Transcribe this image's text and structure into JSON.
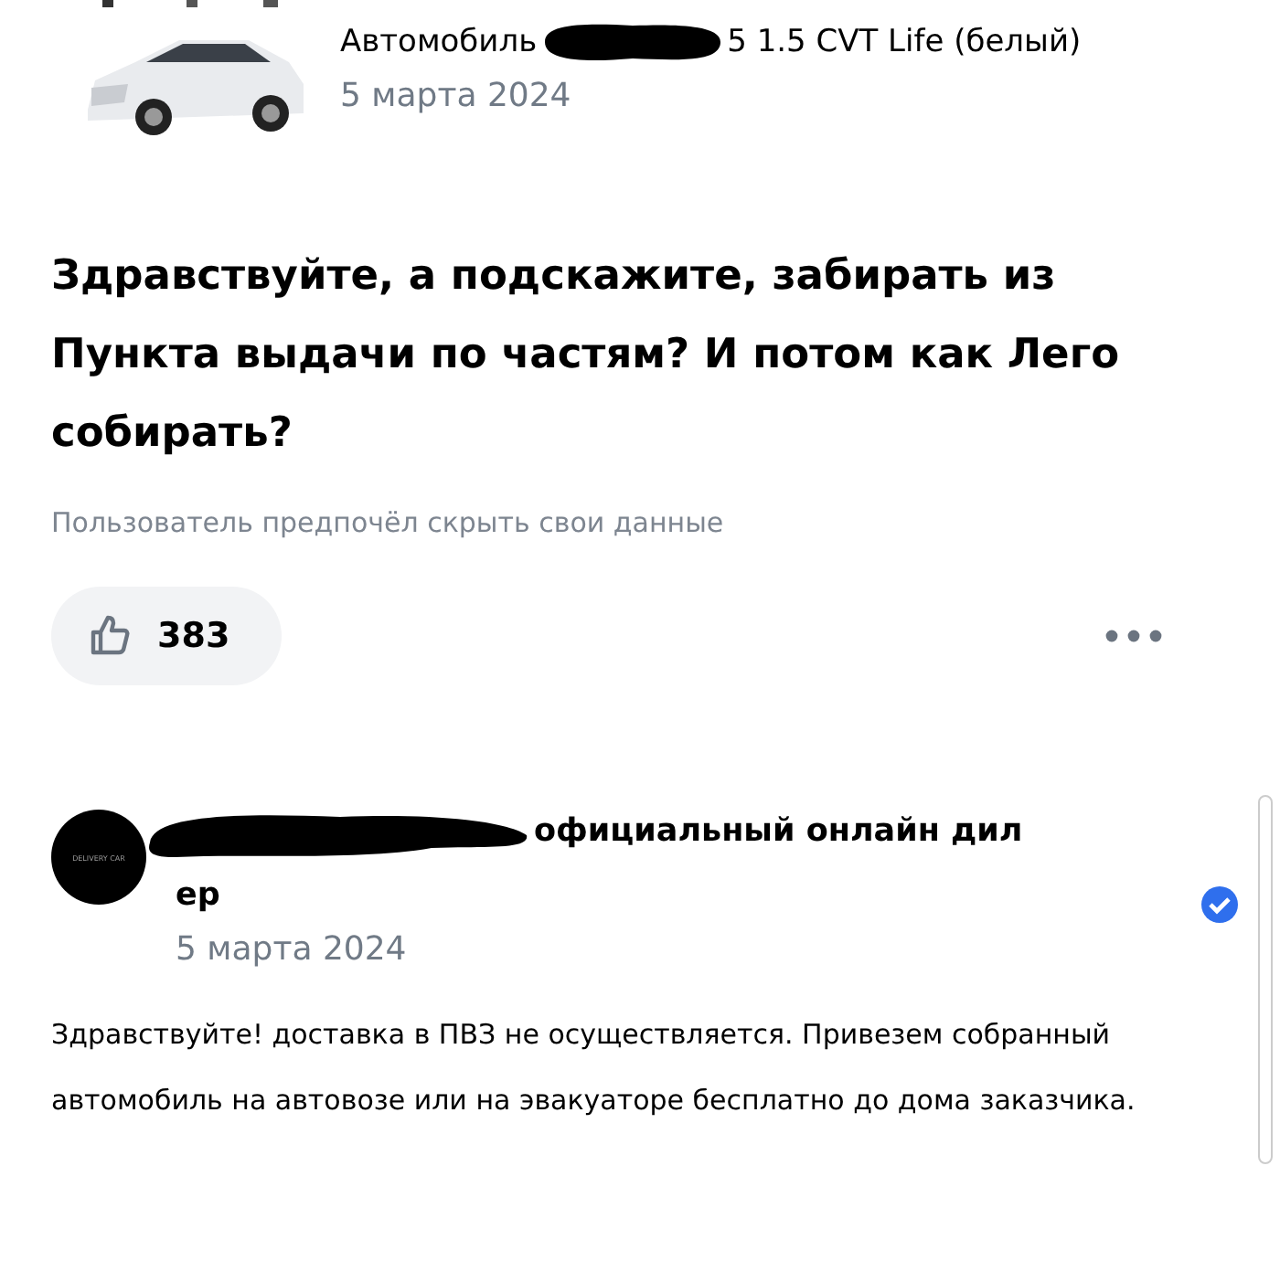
{
  "product": {
    "title_start": "Автомобиль",
    "title_end": "5 1.5 CVT Life (белый)",
    "date": "5 марта 2024"
  },
  "question": {
    "text": "Здравствуйте, а подскажите, забирать из Пункта выдачи по частям? И потом как Лего собирать?",
    "author_note": "Пользователь предпочёл скрыть свои данные",
    "likes": "383",
    "liked": false
  },
  "answer": {
    "avatar_text": "DELIVERY CAR",
    "name_lines": [
      "официальный онлайн дил",
      "ер"
    ],
    "verified": true,
    "date": "5 марта 2024",
    "text": "Здравствуйте! доставка в ПВЗ не осуществляется. Привезем собранный автомобиль на автовозе или на эвакуаторе бесплатно до дома заказчика."
  }
}
